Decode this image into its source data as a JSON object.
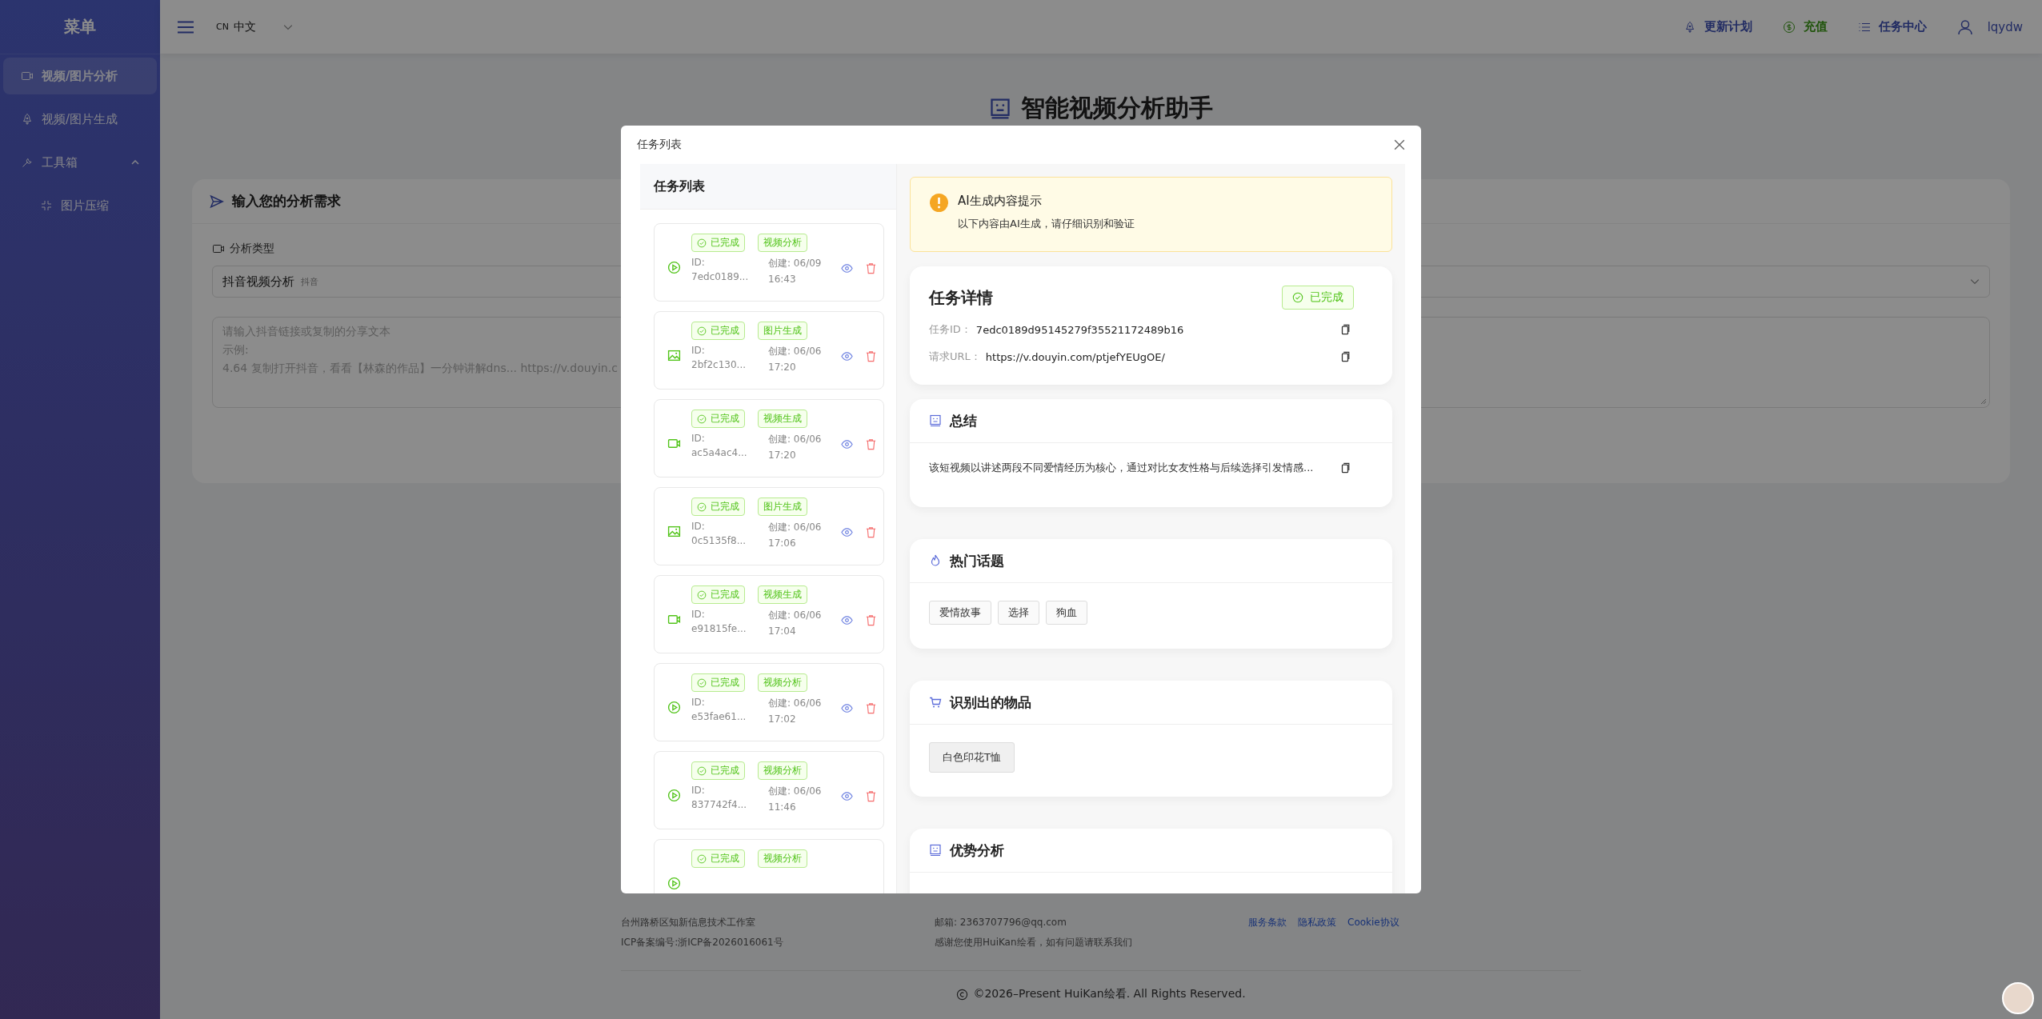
{
  "sidebar": {
    "title": "菜单",
    "items": [
      {
        "kind": "video",
        "label": "视频/图片分析",
        "selected": true
      },
      {
        "kind": "rocket",
        "label": "视频/图片生成",
        "selected": false
      },
      {
        "kind": "wrench",
        "label": "工具箱",
        "selected": false,
        "expanded": true,
        "children": [
          {
            "kind": "compress",
            "label": "图片压缩",
            "selected": false
          }
        ]
      }
    ]
  },
  "topbar": {
    "language_code": "CN",
    "language": "中文",
    "links": [
      {
        "kind": "rocket",
        "label": "更新计划"
      },
      {
        "kind": "dollar",
        "label": "充值"
      },
      {
        "kind": "list",
        "label": "任务中心"
      }
    ],
    "user": "lqydw"
  },
  "page": {
    "title": "智能视频分析助手",
    "form": {
      "title": "输入您的分析需求",
      "type_label": "分析类型",
      "type_value": "抖音视频分析",
      "type_hint": "抖音",
      "placeholder_lines": [
        "请输入抖音链接或复制的分享文本",
        "示例:",
        "4.64 复制打开抖音，看看【林森的作品】一分钟讲解dns... https://v.douyin.c"
      ]
    }
  },
  "footer": {
    "columns": [
      {
        "lines": [
          "台州路桥区知新信息技术工作室",
          "ICP备案编号:浙ICP备2026016061号"
        ]
      },
      {
        "lines": [
          "邮箱: 2363707796@qq.com",
          "感谢您使用HuiKan绘看，如有问题请联系我们"
        ]
      },
      {
        "links": [
          "服务条款",
          "隐私政策",
          "Cookie协议"
        ]
      }
    ],
    "copyright": "©2026–Present HuiKan绘看. All Rights Reserved."
  },
  "modal": {
    "title": "任务列表",
    "list_title": "任务列表",
    "tasks": [
      {
        "kind": "play",
        "status": "已完成",
        "type": "视频分析",
        "id_label": "ID:",
        "id": "7edc0189...",
        "created": "创建: 06/09",
        "time": "16:43"
      },
      {
        "kind": "image",
        "status": "已完成",
        "type": "图片生成",
        "id_label": "ID:",
        "id": "2bf2c130...",
        "created": "创建: 06/06",
        "time": "17:20"
      },
      {
        "kind": "video",
        "status": "已完成",
        "type": "视频生成",
        "id_label": "ID:",
        "id": "ac5a4ac4...",
        "created": "创建: 06/06",
        "time": "17:20"
      },
      {
        "kind": "image",
        "status": "已完成",
        "type": "图片生成",
        "id_label": "ID:",
        "id": "0c5135f8...",
        "created": "创建: 06/06",
        "time": "17:06"
      },
      {
        "kind": "video",
        "status": "已完成",
        "type": "视频生成",
        "id_label": "ID:",
        "id": "e91815fe...",
        "created": "创建: 06/06",
        "time": "17:04"
      },
      {
        "kind": "play",
        "status": "已完成",
        "type": "视频分析",
        "id_label": "ID:",
        "id": "e53fae61...",
        "created": "创建: 06/06",
        "time": "17:02"
      },
      {
        "kind": "play",
        "status": "已完成",
        "type": "视频分析",
        "id_label": "ID:",
        "id": "837742f4...",
        "created": "创建: 06/06",
        "time": "11:46"
      },
      {
        "kind": "play",
        "status": "已完成",
        "type": "视频分析"
      }
    ],
    "notice": {
      "title": "AI生成内容提示",
      "text": "以下内容由AI生成，请仔细识别和验证"
    },
    "detail": {
      "title": "任务详情",
      "status": "已完成",
      "fields": [
        {
          "label": "任务ID：",
          "value": "7edc0189d95145279f35521172489b16"
        },
        {
          "label": "请求URL：",
          "value": "https://v.douyin.com/ptjefYEUgOE/"
        }
      ]
    },
    "sections": [
      {
        "kind": "text",
        "title": "总结",
        "text": "该短视频以讲述两段不同爱情经历为核心，通过对比女友性格与后续选择引发情感..."
      },
      {
        "kind": "tags",
        "title": "热门话题",
        "tags": [
          "爱情故事",
          "选择",
          "狗血"
        ]
      },
      {
        "kind": "items",
        "title": "识别出的物品",
        "items": [
          "白色印花T恤"
        ]
      },
      {
        "kind": "text",
        "title": "优势分析"
      }
    ]
  }
}
